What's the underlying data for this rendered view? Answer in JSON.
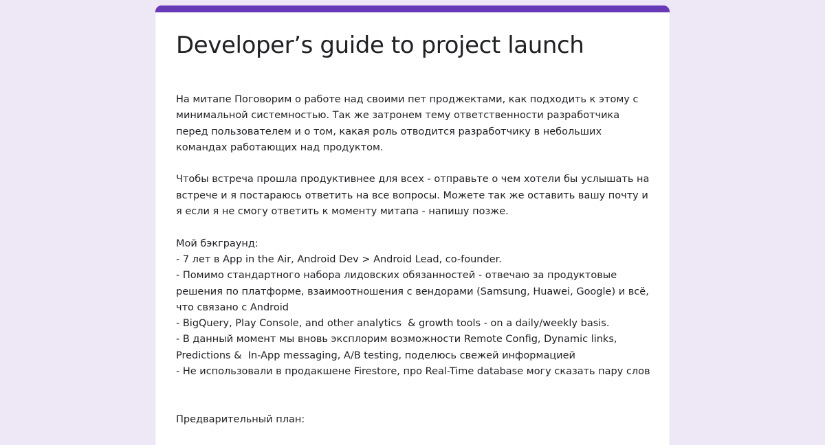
{
  "form": {
    "title": "Developer’s guide to project launch",
    "description": "На митапе Поговорим о работе над своими пет проджектами, как подходить к этому с минимальной системностью. Так же затронем тему ответственности разработчика перед пользователем и о том, какая роль отводится разработчику в небольших командах работающих над продуктом.\n\nЧтобы встреча прошла продуктивнее для всех - отправьте о чем хотели бы услышать на встрече и я постараюсь ответить на все вопросы. Можете так же оставить вашу почту и я если я не смогу ответить к моменту митапа - напишу позже.\n\nМой бэкграунд:\n- 7 лет в App in the Air, Android Dev > Android Lead, co-founder.\n- Помимо стандартного набора лидовских обязанностей - отвечаю за продуктовые решения по платформе, взаимоотношения с вендорами (Samsung, Huawei, Google) и всё, что связано с Android\n- BigQuery, Play Console, and other analytics  & growth tools - on a daily/weekly basis.\n- В данный момент мы вновь эксплорим возможности Remote Config, Dynamic links, Predictions &  In-App messaging, A/B testing, поделюсь свежей информацией\n- Не использовали в продакшене Firestore, про Real-Time database могу сказать пару слов\n\n\nПредварительный план:",
    "accent_color": "#673ab7",
    "background_color": "#ede7f6"
  }
}
